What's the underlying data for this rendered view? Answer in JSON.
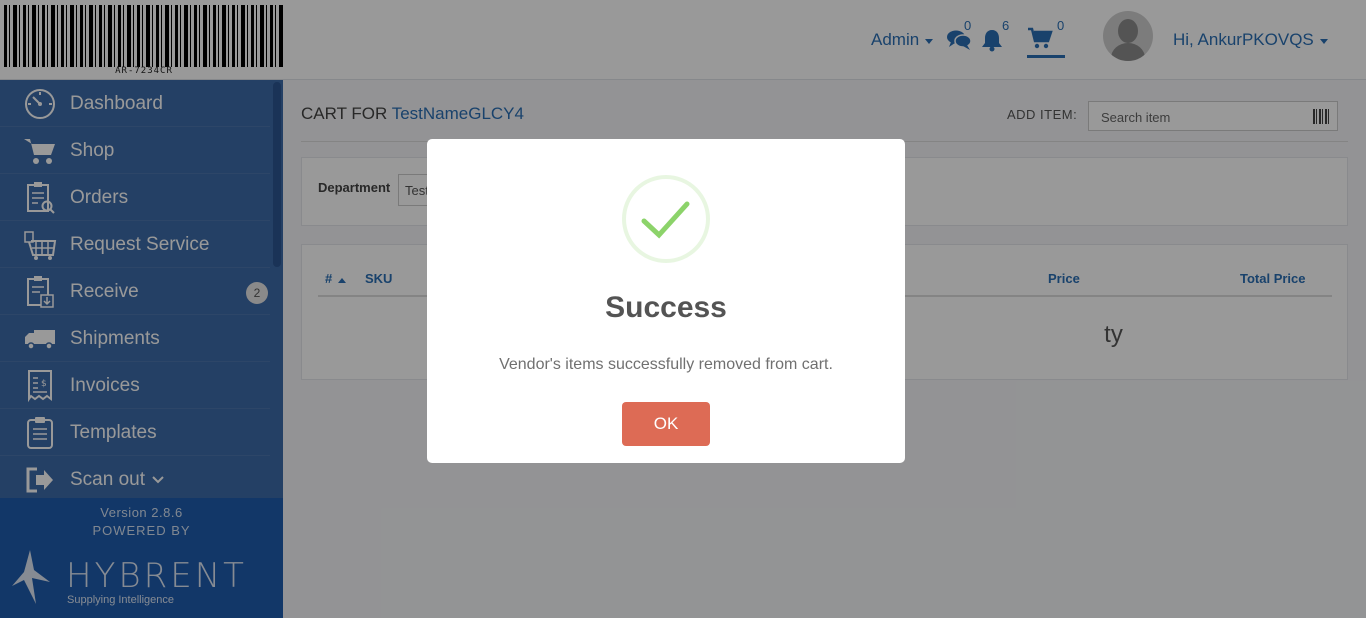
{
  "header": {
    "barcode_text": "AR-7234CR",
    "admin_label": "Admin",
    "messages_count": "0",
    "notifications_count": "6",
    "cart_count": "0",
    "user_greeting": "Hi, AnkurPKOVQS"
  },
  "sidebar": {
    "items": [
      {
        "label": "Dashboard",
        "icon": "dashboard-icon"
      },
      {
        "label": "Shop",
        "icon": "cart-icon"
      },
      {
        "label": "Orders",
        "icon": "orders-icon"
      },
      {
        "label": "Request Service",
        "icon": "request-service-icon"
      },
      {
        "label": "Receive",
        "icon": "receive-icon",
        "badge": "2"
      },
      {
        "label": "Shipments",
        "icon": "truck-icon"
      },
      {
        "label": "Invoices",
        "icon": "invoice-icon"
      },
      {
        "label": "Templates",
        "icon": "templates-icon"
      },
      {
        "label": "Scan out",
        "icon": "scan-out-icon"
      }
    ],
    "version": "Version 2.8.6",
    "powered_by": "POWERED BY",
    "brand_name": "HYBRENT",
    "brand_tagline": "Supplying Intelligence"
  },
  "main": {
    "cart_title_prefix": "CART FOR",
    "cart_name": "TestNameGLCY4",
    "add_item_label": "ADD ITEM:",
    "search_placeholder": "Search item",
    "department_label": "Department",
    "department_value": "Test",
    "table_headers": [
      "#",
      "SKU",
      "Price",
      "Total Price"
    ],
    "empty_text_fragment": "ty"
  },
  "modal": {
    "title": "Success",
    "message": "Vendor's items successfully removed from cart.",
    "ok_label": "OK"
  },
  "colors": {
    "accent": "#2a6fb5",
    "sidebar": "#3d6ba8",
    "ok_button": "#dd6b55",
    "success_check": "#8cd36a"
  }
}
